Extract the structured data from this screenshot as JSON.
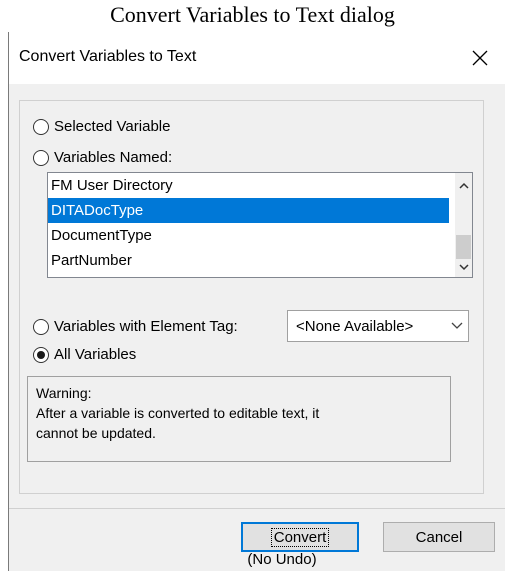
{
  "caption": "Convert Variables to Text dialog",
  "window": {
    "title": "Convert Variables to Text",
    "close_icon": "close-icon"
  },
  "options": {
    "selected_variable": "Selected Variable",
    "variables_named": "Variables Named:",
    "variables_with_element_tag": "Variables with Element Tag:",
    "all_variables": "All Variables",
    "checked": "all_variables"
  },
  "variables_list": {
    "items": [
      "FM User Directory",
      "DITADocType",
      "DocumentType",
      "PartNumber"
    ],
    "selected_index": 1
  },
  "element_tag_select": {
    "value": "<None Available>"
  },
  "warning": {
    "heading": "Warning:",
    "line1": "After a variable is converted to editable text, it",
    "line2": "cannot be updated."
  },
  "buttons": {
    "convert": "Convert",
    "cancel": "Cancel"
  },
  "footer_note": "(No Undo)",
  "colors": {
    "selection": "#0078d7",
    "dialog_bg": "#f0f0f0",
    "title_bg": "#ffffff"
  }
}
